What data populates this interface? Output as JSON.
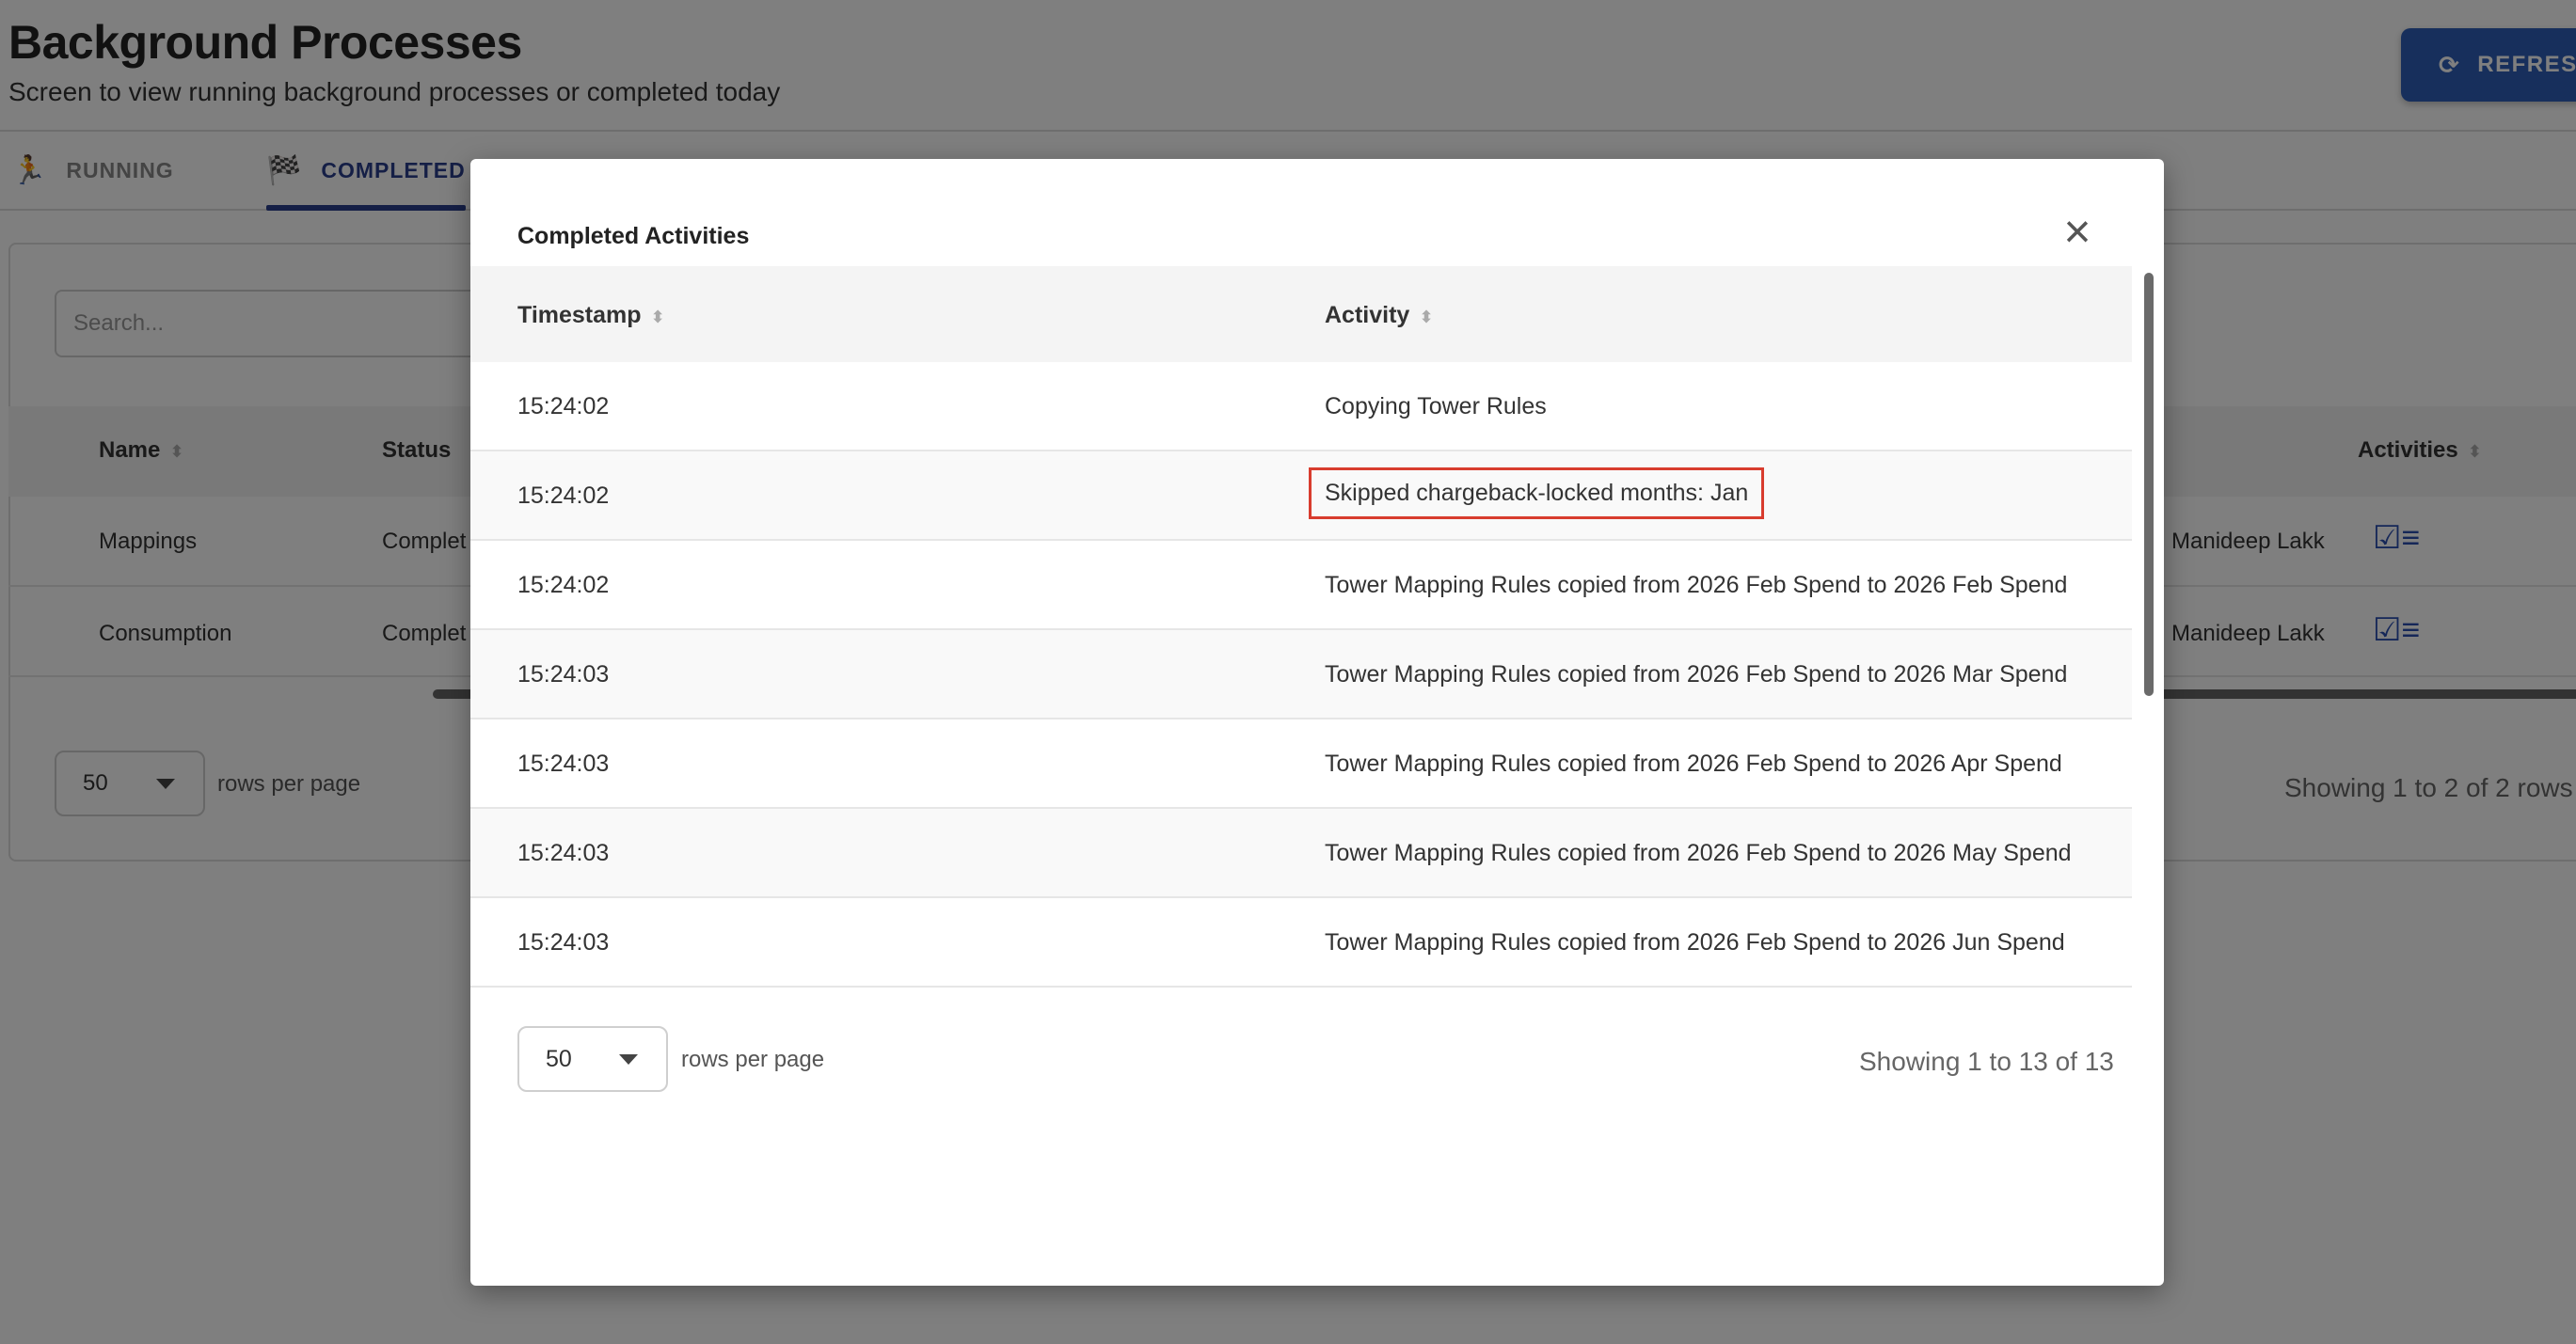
{
  "page": {
    "title": "Background Processes",
    "subtitle": "Screen to view running background processes or completed today",
    "refresh_label": "REFRESH"
  },
  "tabs": [
    {
      "label": "RUNNING",
      "icon": "running-person-icon",
      "active": false
    },
    {
      "label": "COMPLETED",
      "icon": "checkered-flag-icon",
      "active": true
    }
  ],
  "background_table": {
    "search_placeholder": "Search...",
    "columns": [
      "Name",
      "Status",
      "Activities"
    ],
    "rows": [
      {
        "name": "Mappings",
        "status": "Complet",
        "user": "Manideep Lakk"
      },
      {
        "name": "Consumption",
        "status": "Complet",
        "user": "Manideep Lakk"
      }
    ],
    "rows_per_page": "50",
    "rows_per_page_label": "rows per page",
    "showing": "Showing 1 to 2 of 2 rows"
  },
  "modal": {
    "title": "Completed Activities",
    "columns": {
      "timestamp": "Timestamp",
      "activity": "Activity"
    },
    "rows": [
      {
        "timestamp": "15:24:02",
        "activity": "Copying Tower Rules"
      },
      {
        "timestamp": "15:24:02",
        "activity": "Skipped chargeback-locked months: Jan"
      },
      {
        "timestamp": "15:24:02",
        "activity": "Tower Mapping Rules copied from 2026 Feb Spend to 2026 Feb Spend"
      },
      {
        "timestamp": "15:24:03",
        "activity": "Tower Mapping Rules copied from 2026 Feb Spend to 2026 Mar Spend"
      },
      {
        "timestamp": "15:24:03",
        "activity": "Tower Mapping Rules copied from 2026 Feb Spend to 2026 Apr Spend"
      },
      {
        "timestamp": "15:24:03",
        "activity": "Tower Mapping Rules copied from 2026 Feb Spend to 2026 May Spend"
      },
      {
        "timestamp": "15:24:03",
        "activity": "Tower Mapping Rules copied from 2026 Feb Spend to 2026 Jun Spend"
      }
    ],
    "rows_per_page": "50",
    "rows_per_page_label": "rows per page",
    "showing": "Showing 1 to 13 of 13"
  },
  "colors": {
    "accent": "#2b3f8c",
    "refresh_button": "#2f5fb8",
    "highlight_box": "#d83c2e",
    "overlay": "rgba(0,0,0,0.5)"
  }
}
